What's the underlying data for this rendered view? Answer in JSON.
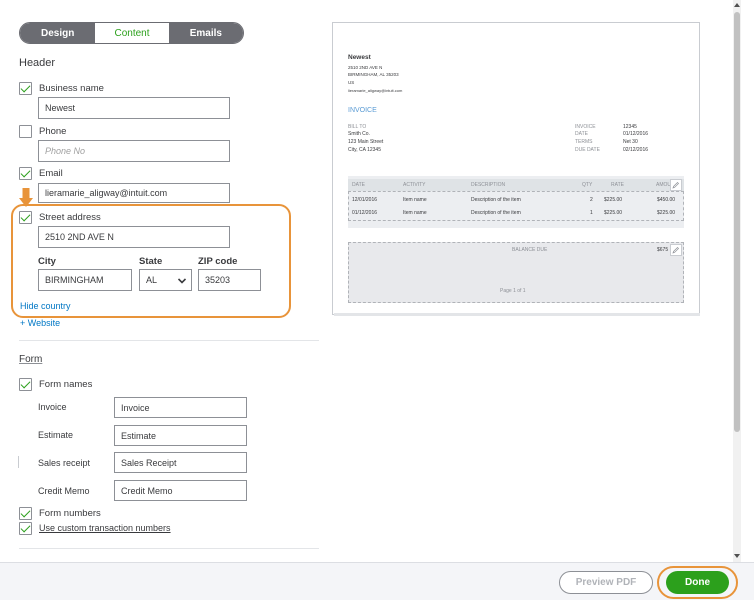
{
  "tabs": {
    "design": "Design",
    "content": "Content",
    "emails": "Emails"
  },
  "header": {
    "title": "Header",
    "business_name": {
      "label": "Business name",
      "checked": true,
      "value": "Newest"
    },
    "phone": {
      "label": "Phone",
      "checked": false,
      "placeholder": "Phone No"
    },
    "email": {
      "label": "Email",
      "checked": true,
      "value": "lieramarie_aligway@intuit.com"
    },
    "street_address": {
      "label": "Street address",
      "checked": true,
      "value": "2510 2ND AVE N"
    },
    "city": {
      "label": "City",
      "value": "BIRMINGHAM"
    },
    "state": {
      "label": "State",
      "value": "AL"
    },
    "zip": {
      "label": "ZIP code",
      "value": "35203"
    },
    "hide_country": "Hide country",
    "website": "+ Website"
  },
  "form": {
    "title": "Form",
    "form_names": {
      "label": "Form names",
      "checked": true
    },
    "rows": [
      {
        "label": "Invoice",
        "value": "Invoice"
      },
      {
        "label": "Estimate",
        "value": "Estimate"
      },
      {
        "label": "Sales receipt",
        "value": "Sales Receipt"
      },
      {
        "label": "Credit Memo",
        "value": "Credit Memo"
      }
    ],
    "form_numbers": {
      "label": "Form numbers",
      "checked": true
    },
    "custom_numbers": {
      "label": "Use custom transaction numbers",
      "checked": true
    }
  },
  "preview": {
    "company": "Newest",
    "address1": "2510 2ND AVE N",
    "address2": "BIRMINGHAM, AL 35203",
    "country": "US",
    "email": "lieramarie_aligway@intuit.com",
    "invoice_title": "INVOICE",
    "bill_to_label": "BILL TO",
    "bill_to_lines": [
      "Smith Co.",
      "123 Main Street",
      "City, CA 12345"
    ],
    "meta": [
      {
        "label": "INVOICE",
        "value": "12345"
      },
      {
        "label": "DATE",
        "value": "01/12/2016"
      },
      {
        "label": "TERMS",
        "value": "Net 30"
      },
      {
        "label": "DUE DATE",
        "value": "02/12/2016"
      }
    ],
    "columns": [
      "DATE",
      "ACTIVITY",
      "DESCRIPTION",
      "QTY",
      "RATE",
      "AMOU"
    ],
    "rows": [
      {
        "date": "12/01/2016",
        "activity": "Item name",
        "description": "Description of the item",
        "qty": "2",
        "rate": "$225.00",
        "amount": "$450.00"
      },
      {
        "date": "01/12/2016",
        "activity": "Item name",
        "description": "Description of the item",
        "qty": "1",
        "rate": "$225.00",
        "amount": "$225.00"
      }
    ],
    "balance_due_label": "BALANCE DUE",
    "balance_due_value": "$675",
    "page_label": "Page 1 of 1"
  },
  "footer": {
    "preview_pdf": "Preview PDF",
    "done": "Done"
  },
  "colors": {
    "accent": "#2ca01c",
    "highlight": "#e8943a",
    "tab_bg": "#6b6c72",
    "link": "#0077c5"
  },
  "icons": [
    "check-icon",
    "chevron-down-icon",
    "pencil-icon",
    "arrow-down-icon"
  ]
}
